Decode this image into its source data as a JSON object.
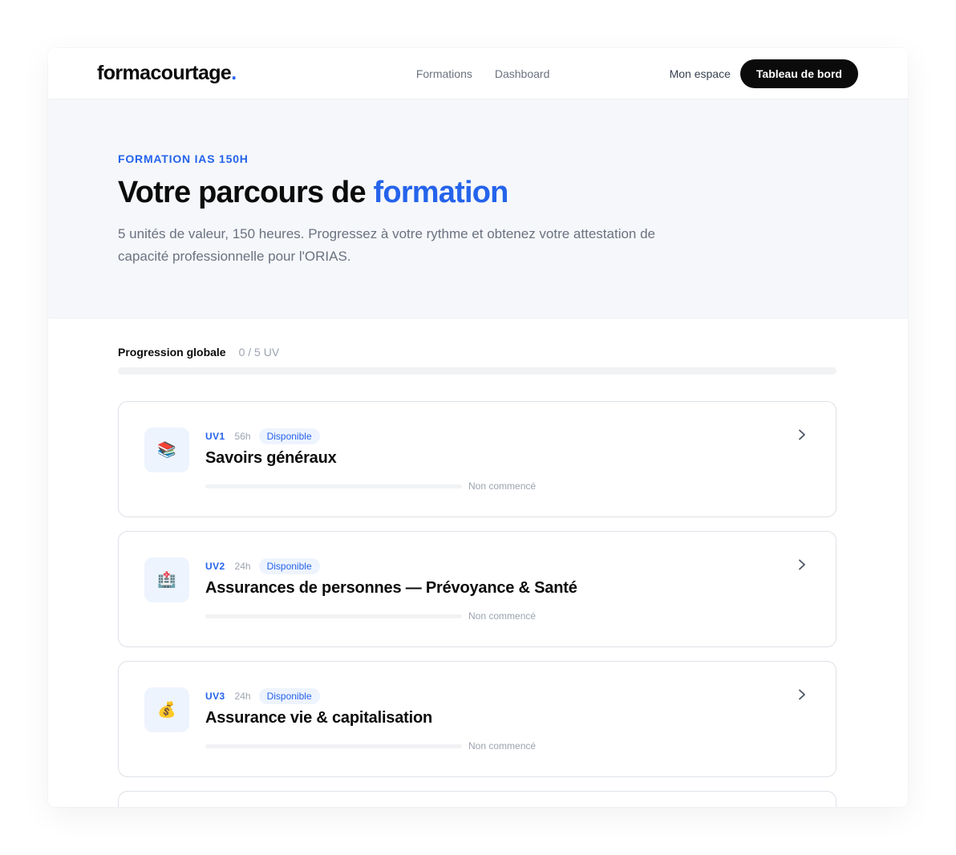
{
  "nav": {
    "logo_text": "formacourtage",
    "logo_dot": ".",
    "links": [
      "Formations",
      "Dashboard"
    ],
    "espace_label": "Mon espace",
    "cta_label": "Tableau de bord"
  },
  "hero": {
    "eyebrow": "FORMATION IAS 150H",
    "title_prefix": "Votre parcours de ",
    "title_accent": "formation",
    "subtitle": "5 unités de valeur, 150 heures. Progressez à votre rythme et obtenez votre attestation de capacité professionnelle pour l'ORIAS."
  },
  "progress": {
    "label": "Progression globale",
    "count": "0 / 5 UV",
    "completed": 0,
    "total": 5
  },
  "units": [
    {
      "code": "UV1",
      "hours": "56h",
      "badge": "Disponible",
      "title": "Savoirs généraux",
      "status": "Non commencé",
      "progress": 0,
      "icon": "books-icon",
      "emoji": "📚"
    },
    {
      "code": "UV2",
      "hours": "24h",
      "badge": "Disponible",
      "title": "Assurances de personnes — Prévoyance & Santé",
      "status": "Non commencé",
      "progress": 0,
      "icon": "hospital-icon",
      "emoji": "🏥"
    },
    {
      "code": "UV3",
      "hours": "24h",
      "badge": "Disponible",
      "title": "Assurance vie & capitalisation",
      "status": "Non commencé",
      "progress": 0,
      "icon": "money-bag-icon",
      "emoji": "💰"
    }
  ],
  "colors": {
    "accent": "#2563eb",
    "dark": "#0b0b0b",
    "hero_bg": "#f5f7fa",
    "badge_bg": "#eef4fe"
  }
}
